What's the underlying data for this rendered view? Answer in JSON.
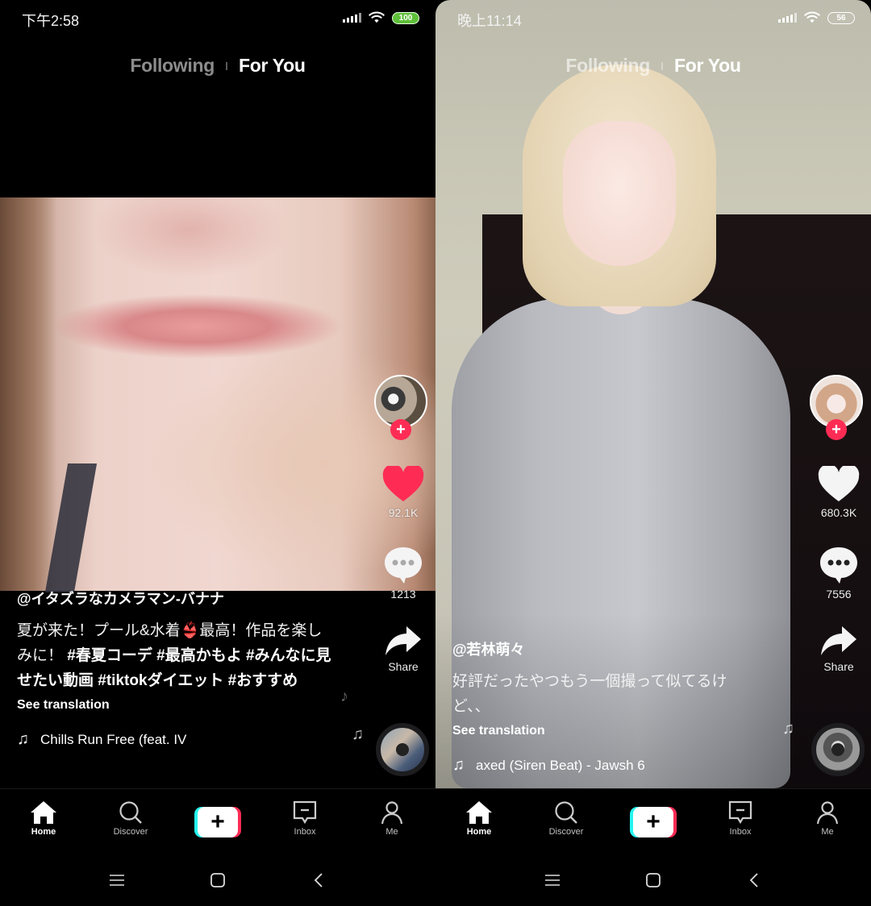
{
  "screens": [
    {
      "status": {
        "time": "下午2:58",
        "battery": "100"
      },
      "tabs": {
        "following": "Following",
        "for_you": "For You",
        "active": "For You"
      },
      "rail": {
        "likes": "92.1K",
        "liked": true,
        "comments": "1213",
        "share_label": "Share"
      },
      "caption": {
        "username": "@イタズラなカメラマン-バナナ",
        "desc_plain_1": "夏が来た！プール&水着👙最高！作品を楽しみに！",
        "hashtags": "#春夏コーデ #最高かもよ #みんなに見せたい動画 #tiktokダイエット #おすすめ",
        "see_translation": "See translation",
        "music": "Chills   Run Free (feat. IV"
      }
    },
    {
      "status": {
        "time": "晚上11:14",
        "battery": "56"
      },
      "tabs": {
        "following": "Following",
        "for_you": "For You",
        "active": "For You"
      },
      "rail": {
        "likes": "680.3K",
        "liked": false,
        "comments": "7556",
        "share_label": "Share"
      },
      "caption": {
        "username": "@若林萌々",
        "desc_plain_1": "好評だったやつもう一個撮って似てるけど、、",
        "hashtags": "",
        "see_translation": "See translation",
        "music": "axed (Siren Beat) - Jawsh 6"
      }
    }
  ],
  "bottom_nav": {
    "items": [
      {
        "label": "Home",
        "icon": "home-icon",
        "active": true
      },
      {
        "label": "Discover",
        "icon": "search-icon",
        "active": false
      },
      {
        "label": "",
        "icon": "create-plus-icon",
        "active": false
      },
      {
        "label": "Inbox",
        "icon": "inbox-icon",
        "active": false
      },
      {
        "label": "Me",
        "icon": "profile-icon",
        "active": false
      }
    ]
  },
  "colors": {
    "accent_red": "#fe2c55",
    "accent_cyan": "#25f4ee",
    "battery_full": "#5fbf3a"
  }
}
